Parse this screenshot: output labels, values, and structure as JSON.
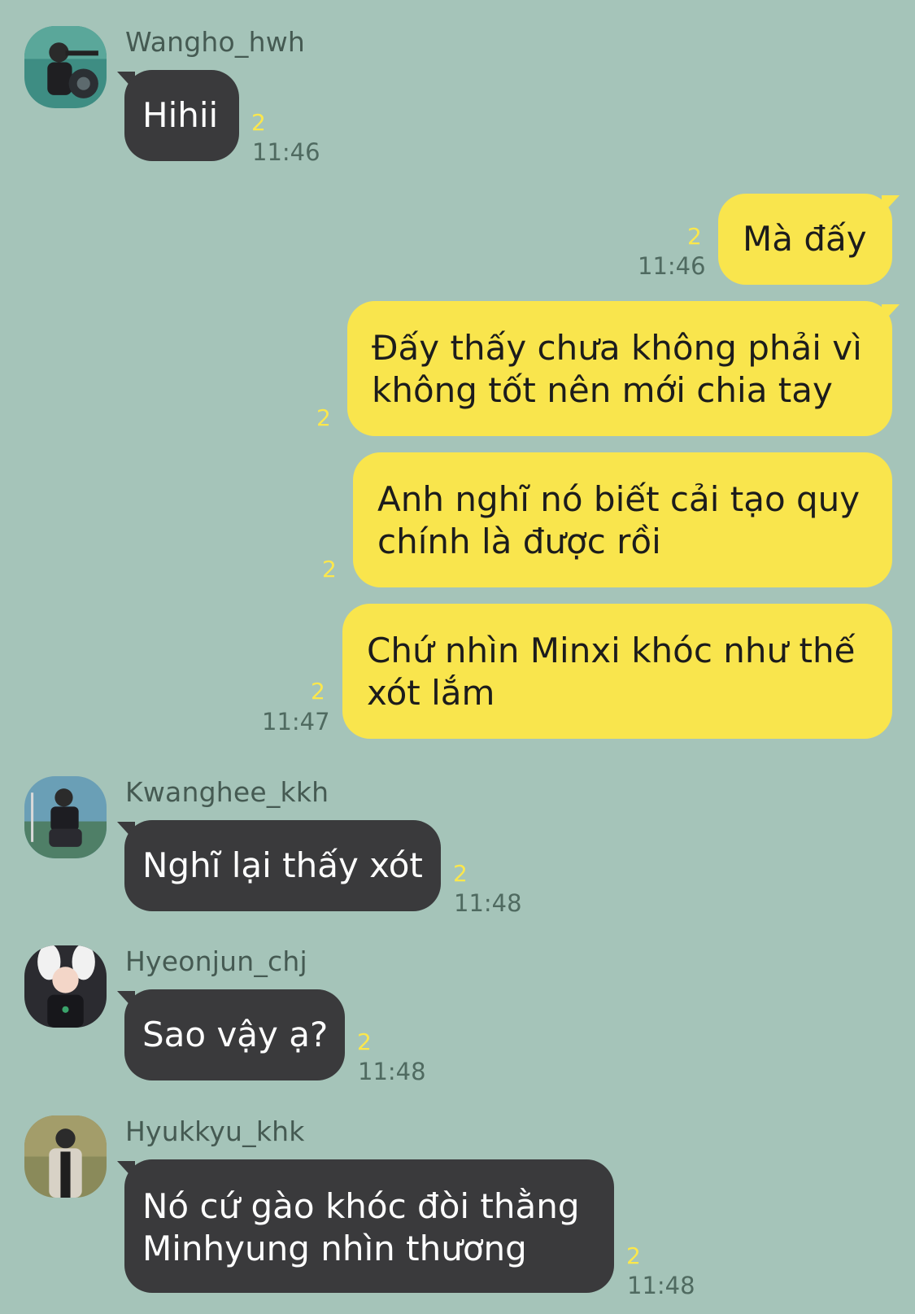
{
  "messages": [
    {
      "sender": "Wangho_hwh",
      "text": "Hihii",
      "unread": "2",
      "time": "11:46"
    },
    {
      "text": "Mà đấy",
      "unread": "2",
      "time": "11:46"
    },
    {
      "text_line1": "Đấy thấy chưa không phải vì",
      "text_line2": "không tốt nên mới chia tay",
      "unread": "2"
    },
    {
      "text_line1": "Anh nghĩ nó biết cải tạo quy",
      "text_line2": "chính là được rồi",
      "unread": "2"
    },
    {
      "text_line1": "Chứ nhìn Minxi khóc như thế",
      "text_line2": "xót lắm",
      "unread": "2",
      "time": "11:47"
    },
    {
      "sender": "Kwanghee_kkh",
      "text": "Nghĩ lại thấy xót",
      "unread": "2",
      "time": "11:48"
    },
    {
      "sender": "Hyeonjun_chj",
      "text": "Sao vậy ạ?",
      "unread": "2",
      "time": "11:48"
    },
    {
      "sender": "Hyukkyu_khk",
      "text_line1": "Nó cứ gào khóc đòi thằng",
      "text_line2": "Minhyung nhìn thương",
      "unread": "2",
      "time": "11:48"
    }
  ],
  "colors": {
    "background": "#a5c4b9",
    "incoming_bubble": "#3a3a3c",
    "outgoing_bubble": "#f9e54d",
    "unread_count": "#fbe74c"
  },
  "icons": [
    "avatar-wangho",
    "avatar-kwanghee",
    "avatar-hyeonjun",
    "avatar-hyukkyu"
  ]
}
